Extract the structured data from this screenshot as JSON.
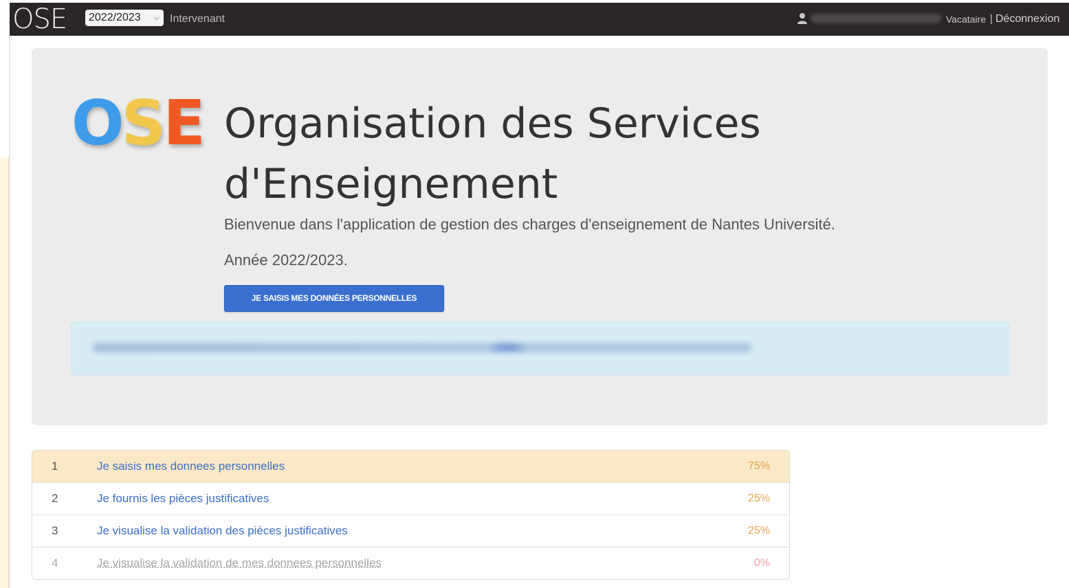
{
  "navbar": {
    "brand": "OSE",
    "year_select": "2022/2023",
    "role_link": "Intervenant",
    "user_status": "Vacataire",
    "separator": "|",
    "logout": "Déconnexion"
  },
  "jumbotron": {
    "logo": {
      "o": "O",
      "s": "S",
      "e": "E"
    },
    "title": "Organisation des Services d'Enseignement",
    "welcome": "Bienvenue dans l'application de gestion des charges d'enseignement de Nantes Université.",
    "year_line": "Année 2022/2023.",
    "primary_button": "JE SAISIS MES DONNÉES PERSONNELLES"
  },
  "steps": [
    {
      "num": "1",
      "label": "Je saisis mes donnees personnelles",
      "pct": "75%"
    },
    {
      "num": "2",
      "label": "Je fournis les pièces justificatives",
      "pct": "25%"
    },
    {
      "num": "3",
      "label": "Je visualise la validation des pièces justificatives",
      "pct": "25%"
    },
    {
      "num": "4",
      "label": "Je visualise la validation de mes donnees personnelles",
      "pct": "0%"
    }
  ],
  "colors": {
    "navbar_bg": "#2a2626",
    "primary": "#3a6fd0",
    "link": "#3a6fc7",
    "active_row": "#fbe8c6",
    "percent": "#e3a64b"
  }
}
